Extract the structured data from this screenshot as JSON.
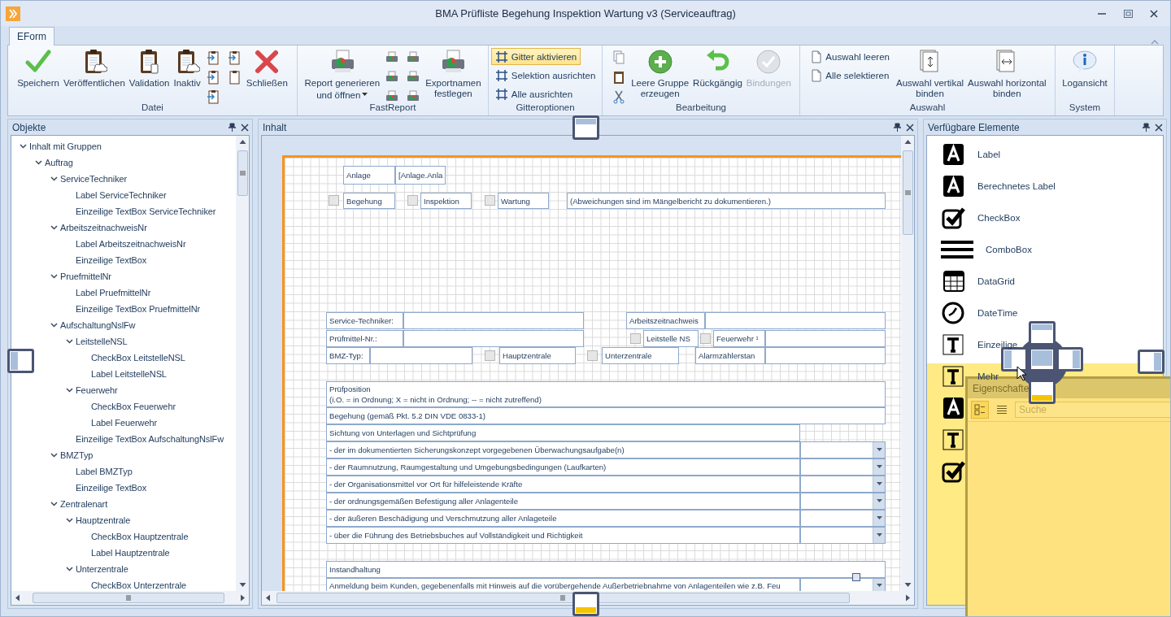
{
  "window": {
    "title": "BMA Prüfliste Begehung Inspektion Wartung v3 (Serviceauftrag)"
  },
  "ribbon": {
    "tabs": [
      {
        "label": "EForm",
        "selected": true
      }
    ],
    "groups": [
      {
        "label": "Datei",
        "items": [
          {
            "kind": "large",
            "label": "Speichern",
            "disabled": false
          },
          {
            "kind": "large",
            "label": "Veröffentlichen",
            "disabled": false
          },
          {
            "kind": "large",
            "label": "Validation",
            "disabled": false
          },
          {
            "kind": "large",
            "label": "Inaktiv",
            "disabled": false
          },
          {
            "kind": "icon-stack"
          },
          {
            "kind": "large",
            "label": "Schließen",
            "disabled": false
          }
        ]
      },
      {
        "label": "FastReport",
        "items": [
          {
            "kind": "large",
            "label": "Report generieren\nund öffnen",
            "disabled": false,
            "dropdown": true
          },
          {
            "kind": "icon-stack"
          },
          {
            "kind": "large",
            "label": "Exportnamen\nfestlegen",
            "disabled": false
          }
        ]
      },
      {
        "label": "Gitteroptionen",
        "items": [
          {
            "kind": "small",
            "label": "Gitter aktivieren",
            "on": true
          },
          {
            "kind": "small",
            "label": "Selektion ausrichten",
            "on": false
          },
          {
            "kind": "small",
            "label": "Alle ausrichten",
            "on": false
          }
        ]
      },
      {
        "label": "Bearbeitung",
        "items": [
          {
            "kind": "icon-stack"
          },
          {
            "kind": "large",
            "label": "Leere Gruppe\nerzeugen",
            "disabled": false
          },
          {
            "kind": "large",
            "label": "Rückgängig",
            "disabled": false
          },
          {
            "kind": "large",
            "label": "Bindungen",
            "disabled": true
          }
        ]
      },
      {
        "label": "Auswahl",
        "items": [
          {
            "kind": "small",
            "label": "Auswahl leeren",
            "on": false
          },
          {
            "kind": "small",
            "label": "Alle selektieren",
            "on": false
          },
          {
            "kind": "large",
            "label": "Auswahl vertikal\nbinden",
            "disabled": false
          },
          {
            "kind": "large",
            "label": "Auswahl horizontal\nbinden",
            "disabled": false
          }
        ]
      },
      {
        "label": "System",
        "items": [
          {
            "kind": "large",
            "label": "Logansicht",
            "disabled": false
          }
        ]
      }
    ]
  },
  "objects_panel": {
    "title": "Objekte",
    "tree": [
      {
        "label": "Inhalt mit Gruppen",
        "expanded": true,
        "children": [
          {
            "label": "Auftrag",
            "expanded": true,
            "children": [
              {
                "label": "ServiceTechniker",
                "expanded": true,
                "children": [
                  {
                    "label": "Label ServiceTechniker"
                  },
                  {
                    "label": "Einzeilige TextBox ServiceTechniker"
                  }
                ]
              },
              {
                "label": "ArbeitszeitnachweisNr",
                "expanded": true,
                "children": [
                  {
                    "label": "Label ArbeitszeitnachweisNr"
                  },
                  {
                    "label": "Einzeilige TextBox"
                  }
                ]
              },
              {
                "label": "PruefmittelNr",
                "expanded": true,
                "children": [
                  {
                    "label": "Label PruefmittelNr"
                  },
                  {
                    "label": "Einzeilige TextBox PruefmittelNr"
                  }
                ]
              },
              {
                "label": "AufschaltungNslFw",
                "expanded": true,
                "children": [
                  {
                    "label": "LeitstelleNSL",
                    "expanded": true,
                    "children": [
                      {
                        "label": "CheckBox LeitstelleNSL"
                      },
                      {
                        "label": "Label LeitstelleNSL"
                      }
                    ]
                  },
                  {
                    "label": "Feuerwehr",
                    "expanded": true,
                    "children": [
                      {
                        "label": "CheckBox Feuerwehr"
                      },
                      {
                        "label": "Label Feuerwehr"
                      }
                    ]
                  },
                  {
                    "label": "Einzeilige TextBox AufschaltungNslFw"
                  }
                ]
              },
              {
                "label": "BMZTyp",
                "expanded": true,
                "children": [
                  {
                    "label": "Label BMZTyp"
                  },
                  {
                    "label": "Einzeilige TextBox"
                  }
                ]
              },
              {
                "label": "Zentralenart",
                "expanded": true,
                "children": [
                  {
                    "label": "Hauptzentrale",
                    "expanded": true,
                    "children": [
                      {
                        "label": "CheckBox Hauptzentrale"
                      },
                      {
                        "label": "Label Hauptzentrale"
                      }
                    ]
                  },
                  {
                    "label": "Unterzentrale",
                    "expanded": true,
                    "children": [
                      {
                        "label": "CheckBox Unterzentrale"
                      }
                    ]
                  }
                ]
              }
            ]
          }
        ]
      }
    ]
  },
  "content_panel": {
    "title": "Inhalt",
    "elements": [
      {
        "kind": "label",
        "text": "Anlage"
      },
      {
        "kind": "field",
        "text": "[Anlage.Anla"
      },
      {
        "kind": "checkbox",
        "checked": false
      },
      {
        "kind": "label",
        "text": "Begehung"
      },
      {
        "kind": "checkbox",
        "checked": false
      },
      {
        "kind": "label",
        "text": "Inspektion"
      },
      {
        "kind": "checkbox",
        "checked": false
      },
      {
        "kind": "label",
        "text": "Wartung"
      },
      {
        "kind": "label",
        "text": "(Abweichungen sind im Mängelbericht zu dokumentieren.)"
      },
      {
        "kind": "label",
        "text": "Service-Techniker:"
      },
      {
        "kind": "field"
      },
      {
        "kind": "label",
        "text": "Arbeitszeitnachweis"
      },
      {
        "kind": "field"
      },
      {
        "kind": "label",
        "text": "Prüfmittel-Nr.:"
      },
      {
        "kind": "field"
      },
      {
        "kind": "checkbox",
        "checked": false
      },
      {
        "kind": "label",
        "text": "Leitstelle NS"
      },
      {
        "kind": "checkbox",
        "checked": false
      },
      {
        "kind": "label",
        "text": "Feuerwehr ¹"
      },
      {
        "kind": "field"
      },
      {
        "kind": "label",
        "text": "BMZ-Typ:"
      },
      {
        "kind": "field"
      },
      {
        "kind": "checkbox",
        "checked": false
      },
      {
        "kind": "label",
        "text": "Hauptzentrale"
      },
      {
        "kind": "checkbox",
        "checked": false
      },
      {
        "kind": "label",
        "text": "Unterzentrale"
      },
      {
        "kind": "label",
        "text": "Alarmzählerstan"
      },
      {
        "kind": "field"
      },
      {
        "kind": "label",
        "text": "Prüfposition\n(i.O. = in Ordnung; X = nicht in Ordnung; -- = nicht zutreffend)"
      },
      {
        "kind": "label",
        "text": "Begehung (gemäß Pkt. 5.2 DIN VDE 0833-1)"
      },
      {
        "kind": "label",
        "text": "Sichtung von Unterlagen und Sichtprüfung"
      },
      {
        "kind": "label",
        "text": "- der im dokumentierten Sicherungskonzept vorgegebenen Überwachungsaufgabe(n)"
      },
      {
        "kind": "combo"
      },
      {
        "kind": "label",
        "text": "- der Raumnutzung, Raumgestaltung und Umgebungsbedingungen (Laufkarten)"
      },
      {
        "kind": "combo"
      },
      {
        "kind": "label",
        "text": "- der Organisationsmittel vor Ort für hilfeleistende Kräfte"
      },
      {
        "kind": "combo"
      },
      {
        "kind": "label",
        "text": "- der ordnungsgemäßen Befestigung aller Anlagenteile"
      },
      {
        "kind": "combo"
      },
      {
        "kind": "label",
        "text": "- der äußeren Beschädigung und Verschmutzung aller Anlageteile"
      },
      {
        "kind": "combo"
      },
      {
        "kind": "label",
        "text": "- über die Führung des Betriebsbuches auf Vollständigkeit und Richtigkeit"
      },
      {
        "kind": "combo"
      },
      {
        "kind": "label",
        "text": "Instandhaltung"
      },
      {
        "kind": "label",
        "text": "Anmeldung beim Kunden, gegebenenfalls mit Hinweis auf die vorübergehende Außerbetriebnahme von Anlagenteilen wie z.B. Feu"
      },
      {
        "kind": "combo"
      }
    ]
  },
  "elements_panel": {
    "title": "Verfügbare Elemente",
    "items": [
      {
        "kind": "labeled",
        "label": "Label"
      },
      {
        "kind": "labeled",
        "label": "Berechnetes Label"
      },
      {
        "kind": "labeled",
        "label": "CheckBox"
      },
      {
        "kind": "labeled",
        "label": "ComboBox"
      },
      {
        "kind": "labeled",
        "label": "DataGrid"
      },
      {
        "kind": "labeled",
        "label": "DateTime"
      },
      {
        "kind": "labeled",
        "label": "Einzeilige"
      },
      {
        "kind": "labeled",
        "label": "Mehr"
      },
      {
        "kind": "icon-only"
      },
      {
        "kind": "icon-only"
      },
      {
        "kind": "icon-only"
      }
    ]
  },
  "properties_window": {
    "title": "Eigenschafte",
    "search": {
      "placeholder": "Suche"
    }
  }
}
